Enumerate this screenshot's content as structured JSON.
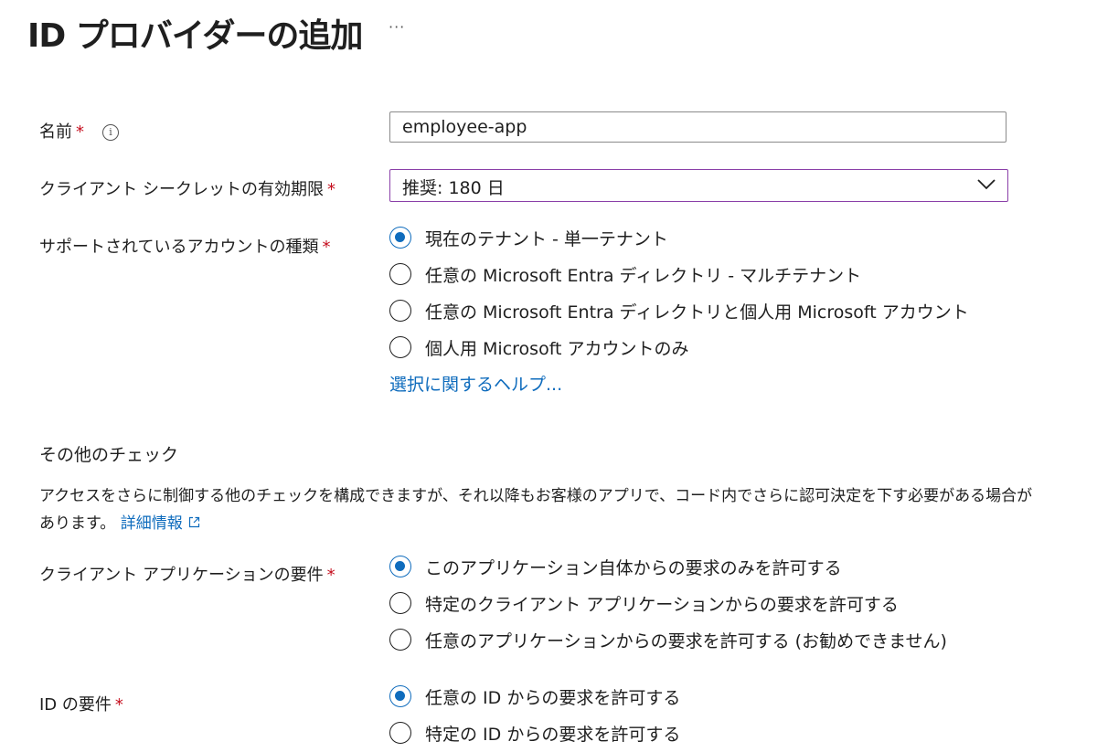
{
  "header": {
    "title": "ID プロバイダーの追加",
    "more_label": "···"
  },
  "name_field": {
    "label": "名前",
    "required": "*",
    "info_icon": "info-icon",
    "value": "employee-app"
  },
  "secret_expiry": {
    "label": "クライアント シークレットの有効期限",
    "required": "*",
    "value": "推奨: 180 日",
    "icon": "chevron-down-icon"
  },
  "account_types": {
    "label": "サポートされているアカウントの種類",
    "required": "*",
    "options": [
      {
        "label": "現在のテナント - 単一テナント",
        "checked": true
      },
      {
        "label": "任意の Microsoft Entra ディレクトリ - マルチテナント",
        "checked": false
      },
      {
        "label": "任意の Microsoft Entra ディレクトリと個人用 Microsoft アカウント",
        "checked": false
      },
      {
        "label": "個人用 Microsoft アカウントのみ",
        "checked": false
      }
    ],
    "help_link": "選択に関するヘルプ..."
  },
  "other_checks": {
    "title": "その他のチェック",
    "description": "アクセスをさらに制御する他のチェックを構成できますが、それ以降もお客様のアプリで、コード内でさらに認可決定を下す必要がある場合があります。",
    "learn_more": "詳細情報",
    "learn_more_icon": "external-link-icon"
  },
  "client_app_requirement": {
    "label": "クライアント アプリケーションの要件",
    "required": "*",
    "options": [
      {
        "label": "このアプリケーション自体からの要求のみを許可する",
        "checked": true
      },
      {
        "label": "特定のクライアント アプリケーションからの要求を許可する",
        "checked": false
      },
      {
        "label": "任意のアプリケーションからの要求を許可する (お勧めできません)",
        "checked": false
      }
    ]
  },
  "identity_requirement": {
    "label": "ID の要件",
    "required": "*",
    "options": [
      {
        "label": "任意の ID からの要求を許可する",
        "checked": true
      },
      {
        "label": "特定の ID からの要求を許可する",
        "checked": false
      }
    ]
  },
  "colors": {
    "accent": "#0f6cbd",
    "required": "#c50f1f",
    "select_border": "#8a3fa8"
  }
}
